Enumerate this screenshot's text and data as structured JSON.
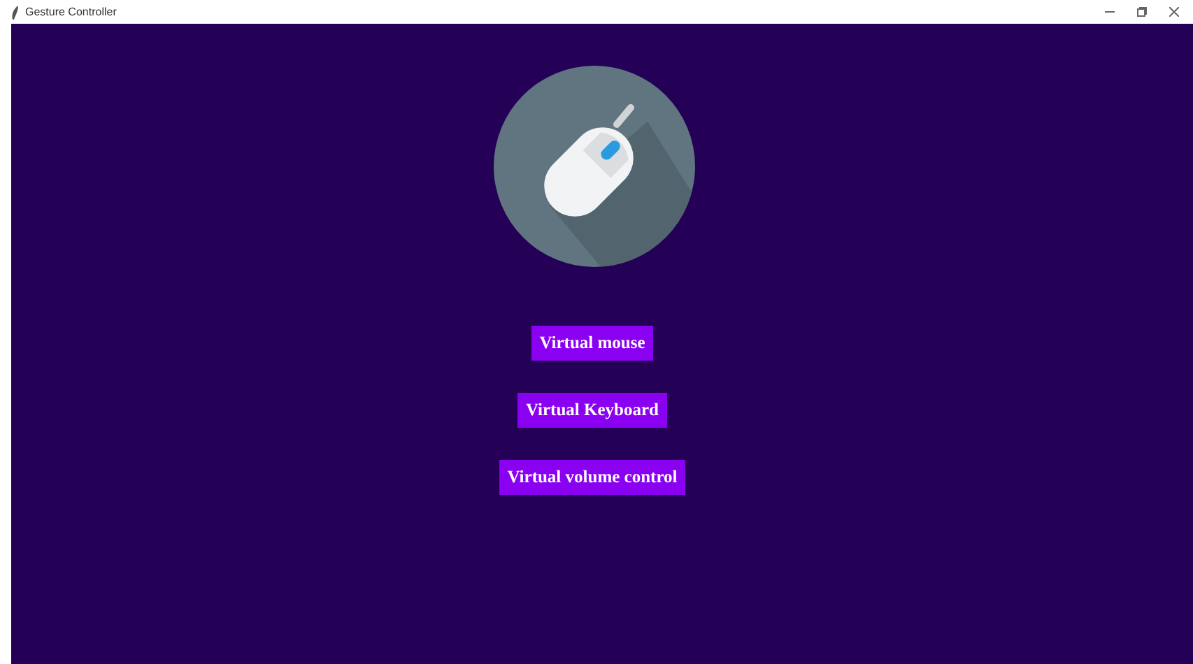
{
  "window": {
    "title": "Gesture Controller"
  },
  "buttons": [
    {
      "label": "Virtual mouse"
    },
    {
      "label": "Virtual Keyboard"
    },
    {
      "label": "Virtual volume control"
    }
  ]
}
